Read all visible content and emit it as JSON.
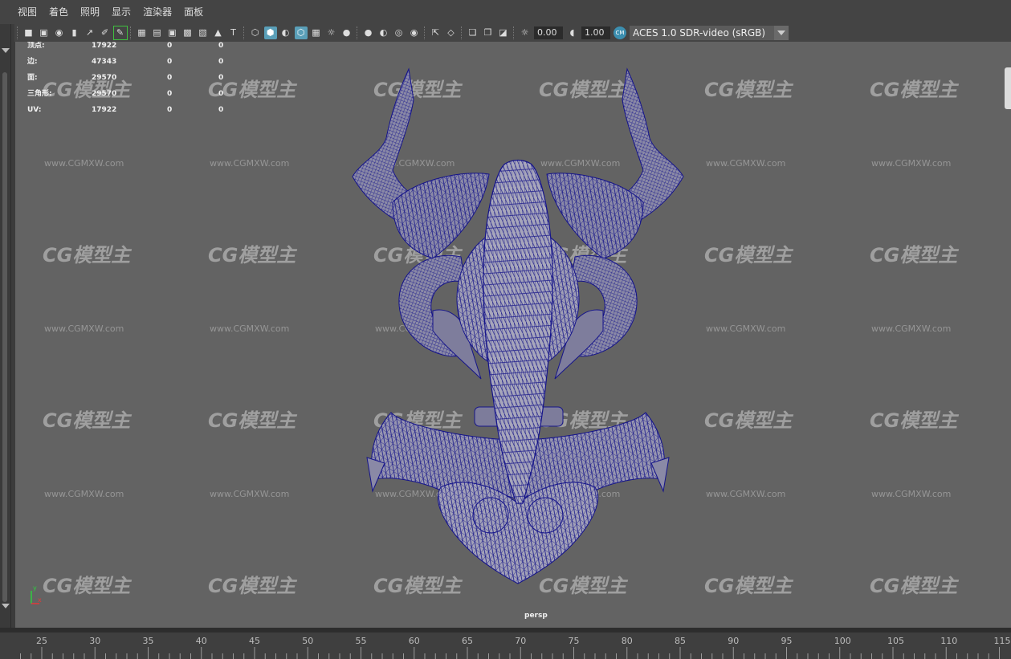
{
  "menu": [
    "视图",
    "着色",
    "照明",
    "显示",
    "渲染器",
    "面板"
  ],
  "toolbar": {
    "exposure_value": "0.00",
    "gamma_value": "1.00",
    "color_space": "ACES 1.0 SDR-video (sRGB)"
  },
  "hud": {
    "rows": [
      {
        "label": "顶点:",
        "v1": "17922",
        "v2": "0",
        "v3": "0"
      },
      {
        "label": "边:",
        "v1": "47343",
        "v2": "0",
        "v3": "0"
      },
      {
        "label": "面:",
        "v1": "29570",
        "v2": "0",
        "v3": "0"
      },
      {
        "label": "三角形:",
        "v1": "29570",
        "v2": "0",
        "v3": "0"
      },
      {
        "label": "UV:",
        "v1": "17922",
        "v2": "0",
        "v3": "0"
      }
    ]
  },
  "viewport": {
    "camera": "persp",
    "axis_y": "y",
    "axis_x": "x",
    "watermark_logo": "CG模型主",
    "watermark_url": "www.CGMXW.com"
  },
  "timeline": {
    "ticks": [
      "25",
      "30",
      "35",
      "40",
      "45",
      "50",
      "55",
      "60",
      "65",
      "70",
      "75",
      "80",
      "85",
      "90",
      "95",
      "100",
      "105",
      "110",
      "115"
    ]
  }
}
